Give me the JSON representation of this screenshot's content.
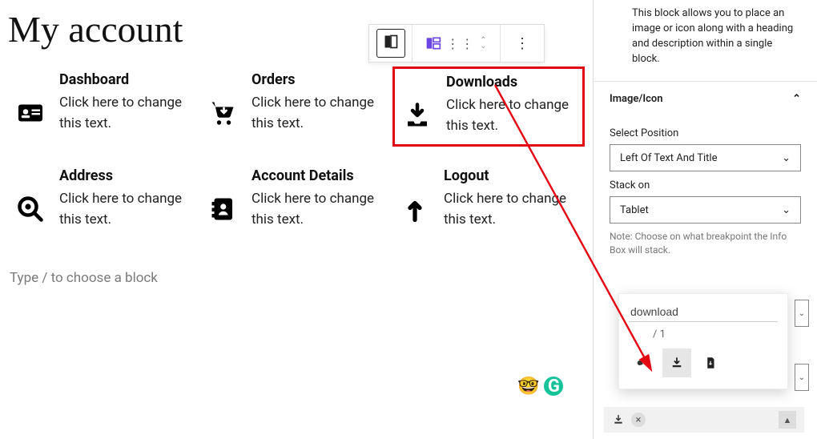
{
  "page_title": "My account",
  "placeholder_prompt": "Type / to choose a block",
  "block_description": "This block allows you to place an image or icon along with a heading and description within a single block.",
  "panel": {
    "section_title": "Image/Icon",
    "position_label": "Select Position",
    "position_value": "Left Of Text And Title",
    "stack_label": "Stack on",
    "stack_value": "Tablet",
    "stack_note": "Note: Choose on what breakpoint the Info Box will stack."
  },
  "icon_picker": {
    "search_value": "download",
    "page_indicator": "/  1"
  },
  "boxes": [
    {
      "title": "Dashboard",
      "desc": "Click here to change this text."
    },
    {
      "title": "Orders",
      "desc": "Click here to change this text."
    },
    {
      "title": "Downloads",
      "desc": "Click here to change this text."
    },
    {
      "title": "Address",
      "desc": "Click here to change this text."
    },
    {
      "title": "Account Details",
      "desc": "Click here to change this text."
    },
    {
      "title": "Logout",
      "desc": "Click here to change this text."
    }
  ]
}
